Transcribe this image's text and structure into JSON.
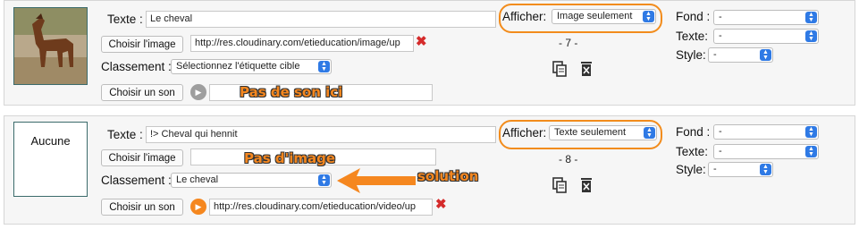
{
  "cards": [
    {
      "thumb_label": "",
      "texte_label": "Texte :",
      "texte_value": "Le cheval",
      "choose_image_label": "Choisir l'image",
      "image_url": "http://res.cloudinary.com/etieducation/image/up",
      "classement_label": "Classement :",
      "classement_value": "Sélectionnez l'étiquette cible",
      "choose_sound_label": "Choisir un son",
      "sound_url": "",
      "afficher_label": "Afficher:",
      "afficher_value": "Image seulement",
      "counter": "- 7 -",
      "fond_label": "Fond :",
      "fond_value": "-",
      "texte2_label": "Texte:",
      "texte2_value": "-",
      "style_label": "Style:",
      "style_value": "-"
    },
    {
      "thumb_label": "Aucune",
      "texte_label": "Texte :",
      "texte_value": "!> Cheval qui hennit",
      "choose_image_label": "Choisir l'image",
      "image_url": "",
      "classement_label": "Classement :",
      "classement_value": "Le cheval",
      "choose_sound_label": "Choisir un son",
      "sound_url": "http://res.cloudinary.com/etieducation/video/up",
      "afficher_label": "Afficher:",
      "afficher_value": "Texte seulement",
      "counter": "- 8 -",
      "fond_label": "Fond :",
      "fond_value": "-",
      "texte2_label": "Texte:",
      "texte2_value": "-",
      "style_label": "Style:",
      "style_value": "-"
    }
  ],
  "annotations": {
    "no_sound": "Pas de son ici",
    "no_image": "Pas d'image",
    "solution": "solution"
  },
  "colors": {
    "highlight": "#f28c1c",
    "annotation": "#f5871f",
    "select_arrow": "#2f7ae5",
    "delete": "#d52b2b"
  },
  "icons": [
    "horse-photo",
    "delete-x-icon",
    "copy-icon",
    "trash-icon",
    "play-icon",
    "select-arrows-icon",
    "arrow-left-icon"
  ]
}
